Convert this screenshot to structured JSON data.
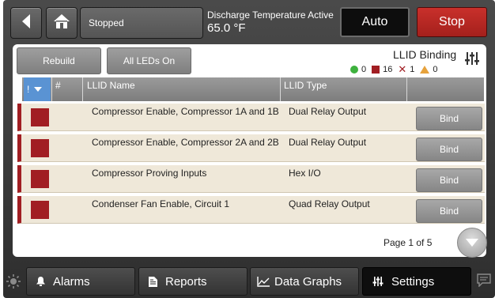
{
  "colors": {
    "stop_red": "#b52a25",
    "led_red": "#a11e23",
    "row_bg": "#efe8d9",
    "header_accent": "#5a93d3",
    "legend_green": "#3eb13e",
    "legend_orange": "#e6a23c"
  },
  "topbar": {
    "back_icon": "back-arrow-icon",
    "home_icon": "home-icon",
    "status": "Stopped",
    "alert_title": "Discharge Temperature Active",
    "alert_value": "65.0 °F",
    "auto_label": "Auto",
    "stop_label": "Stop"
  },
  "toolbar": {
    "rebuild_label": "Rebuild",
    "all_leds_label": "All LEDs On",
    "title": "LLID Binding",
    "counts": {
      "green": "0",
      "red": "16",
      "x": "1",
      "warning": "0"
    }
  },
  "table": {
    "columns": {
      "sort": "!",
      "num": "#",
      "name": "LLID Name",
      "type": "LLID Type"
    },
    "rows": [
      {
        "name": "Compressor Enable, Compressor 1A and 1B",
        "type": "Dual Relay Output",
        "action": "Bind"
      },
      {
        "name": "Compressor Enable, Compressor 2A and 2B",
        "type": "Dual Relay Output",
        "action": "Bind"
      },
      {
        "name": "Compressor Proving Inputs",
        "type": "Hex I/O",
        "action": "Bind"
      },
      {
        "name": "Condenser Fan Enable, Circuit 1",
        "type": "Quad Relay Output",
        "action": "Bind"
      }
    ]
  },
  "pagination": {
    "label": "Page 1 of 5"
  },
  "nav": {
    "alarms": "Alarms",
    "reports": "Reports",
    "data_graphs": "Data Graphs",
    "settings": "Settings"
  }
}
